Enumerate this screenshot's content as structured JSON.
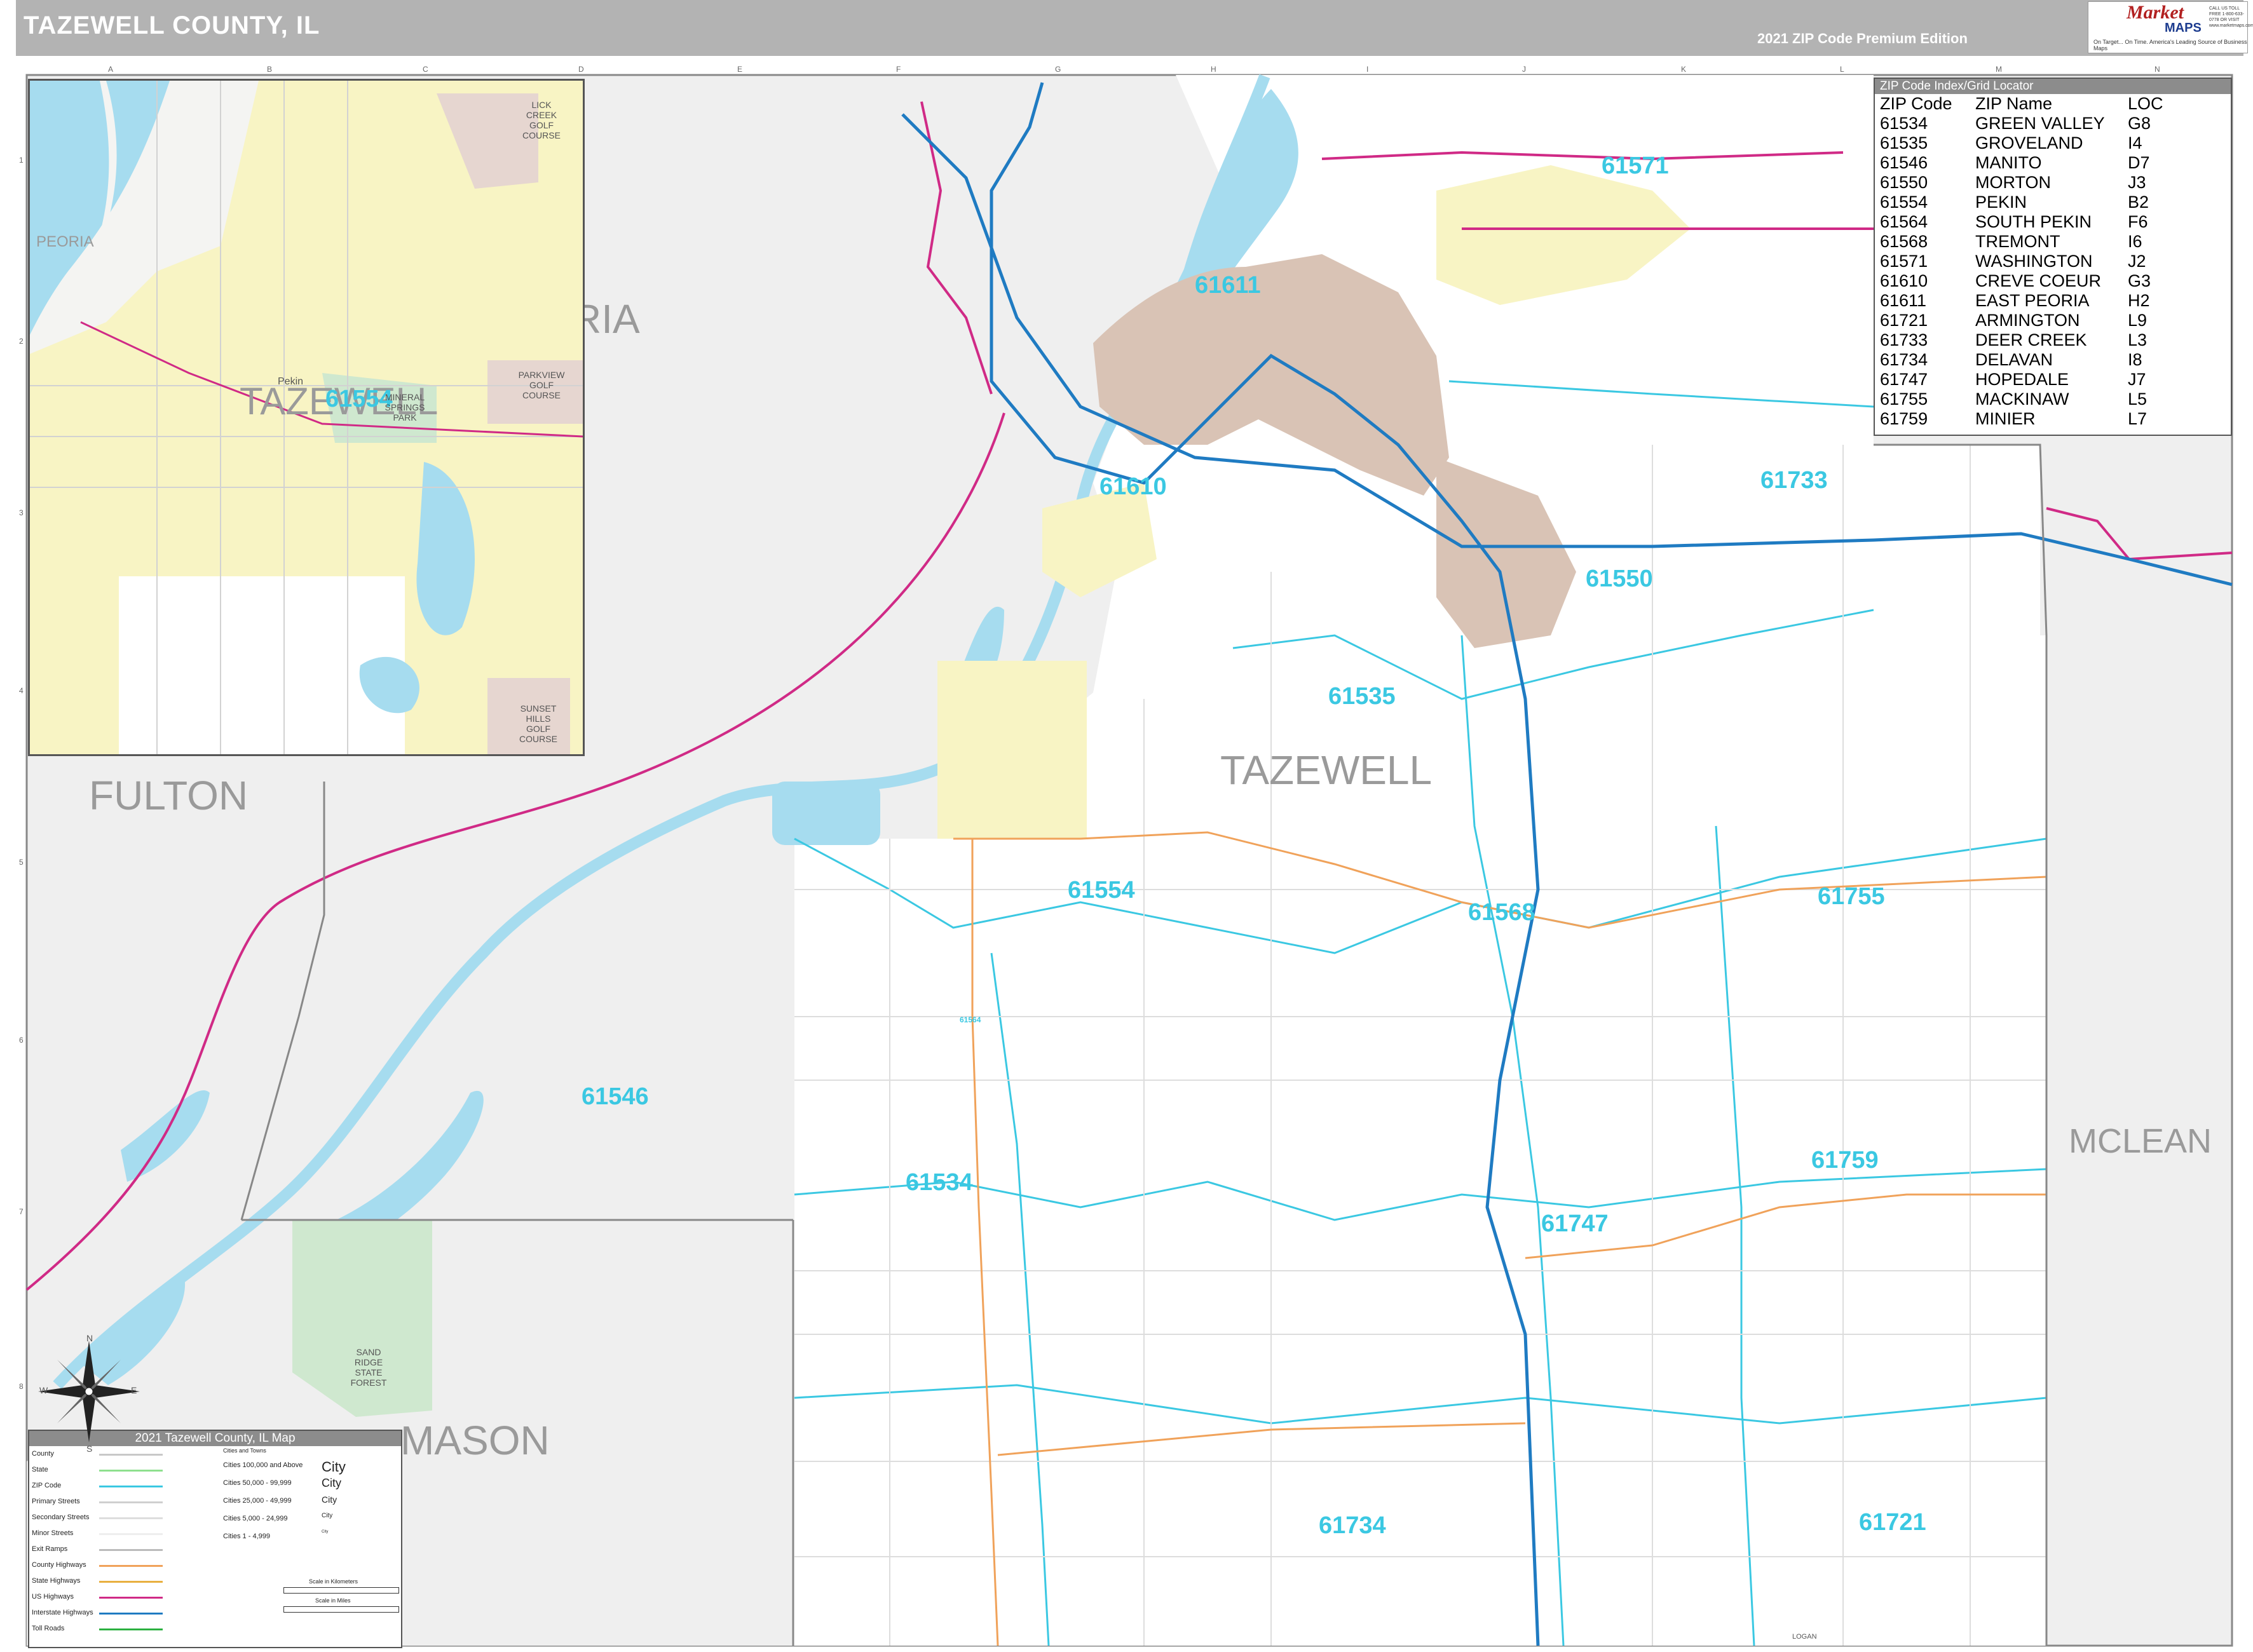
{
  "header": {
    "title": "TAZEWELL COUNTY, IL",
    "edition": "2021 ZIP Code Premium Edition",
    "logo_word": "Market",
    "logo_maps": "MAPS",
    "logo_tagline": "On Target... On Time. America's Leading Source of Business Maps",
    "logo_phone": "CALL US TOLL FREE 1-800-633-0778 OR VISIT www.marketmaps.com"
  },
  "grid_columns": [
    "A",
    "B",
    "C",
    "D",
    "E",
    "F",
    "G",
    "H",
    "I",
    "J",
    "K",
    "L",
    "M",
    "N"
  ],
  "grid_rows": [
    "1",
    "2",
    "3",
    "4",
    "5",
    "6",
    "7",
    "8"
  ],
  "counties": {
    "fulton": "FULTON",
    "mason": "MASON",
    "mclean": "MCLEAN",
    "tazewell": "TAZEWELL",
    "peoria_partial": "RIA",
    "inset_tazewell": "TAZEWELL",
    "inset_peoria": "PEORIA",
    "logan": "LOGAN"
  },
  "zip_labels": [
    {
      "zip": "61571"
    },
    {
      "zip": "61611"
    },
    {
      "zip": "61610"
    },
    {
      "zip": "61733"
    },
    {
      "zip": "61550"
    },
    {
      "zip": "61535"
    },
    {
      "zip": "61554"
    },
    {
      "zip": "61568"
    },
    {
      "zip": "61755"
    },
    {
      "zip": "61546"
    },
    {
      "zip": "61534"
    },
    {
      "zip": "61759"
    },
    {
      "zip": "61747"
    },
    {
      "zip": "61734"
    },
    {
      "zip": "61721"
    },
    {
      "zip": "61554"
    },
    {
      "zip": "61564"
    }
  ],
  "places": {
    "sand_ridge": "SAND RIDGE STATE FOREST",
    "lick_creek": "LICK CREEK GOLF COURSE",
    "parkview": "PARKVIEW GOLF COURSE",
    "mineral_springs": "MINERAL SPRINGS PARK",
    "sunset_hills": "SUNSET HILLS GOLF COURSE",
    "pekin_town": "Pekin"
  },
  "zip_index": {
    "title": "ZIP Code Index/Grid Locator",
    "headers": [
      "ZIP Code",
      "ZIP Name",
      "LOC"
    ],
    "rows": [
      [
        "61534",
        "GREEN VALLEY",
        "G8"
      ],
      [
        "61535",
        "GROVELAND",
        "I4"
      ],
      [
        "61546",
        "MANITO",
        "D7"
      ],
      [
        "61550",
        "MORTON",
        "J3"
      ],
      [
        "61554",
        "PEKIN",
        "B2"
      ],
      [
        "61564",
        "SOUTH PEKIN",
        "F6"
      ],
      [
        "61568",
        "TREMONT",
        "I6"
      ],
      [
        "61571",
        "WASHINGTON",
        "J2"
      ],
      [
        "61610",
        "CREVE COEUR",
        "G3"
      ],
      [
        "61611",
        "EAST PEORIA",
        "H2"
      ],
      [
        "61721",
        "ARMINGTON",
        "L9"
      ],
      [
        "61733",
        "DEER CREEK",
        "L3"
      ],
      [
        "61734",
        "DELAVAN",
        "I8"
      ],
      [
        "61747",
        "HOPEDALE",
        "J7"
      ],
      [
        "61755",
        "MACKINAW",
        "L5"
      ],
      [
        "61759",
        "MINIER",
        "L7"
      ]
    ]
  },
  "legend": {
    "title": "2021 Tazewell County, IL Map",
    "rows": [
      "County",
      "State",
      "ZIP Code",
      "Primary Streets",
      "Secondary Streets",
      "Minor Streets",
      "Exit Ramps",
      "County Highways",
      "State Highways",
      "US Highways",
      "Interstate Highways",
      "Toll Roads"
    ],
    "cities_header": "Cities and Towns",
    "city_rows": [
      [
        "Cities 100,000 and Above",
        "City"
      ],
      [
        "Cities 50,000 - 99,999",
        "City"
      ],
      [
        "Cities 25,000 - 49,999",
        "City"
      ],
      [
        "Cities 5,000 - 24,999",
        "City"
      ],
      [
        "Cities 1 - 4,999",
        "City"
      ]
    ],
    "scale_km": "Scale in Kilometers",
    "scale_mi": "Scale in Miles",
    "colors": {
      "county": "#c8c8c8",
      "state": "#8ee08e",
      "zip": "#3bc8e2",
      "primary": "#cfcfcf",
      "secondary": "#dddddd",
      "minor": "#eeeeee",
      "ramps": "#bbbbbb",
      "county_hwy": "#f0a25a",
      "state_hwy": "#e8b040",
      "us_hwy": "#d02a86",
      "interstate": "#1f7bc2",
      "toll": "#2bb040"
    }
  },
  "compass": {
    "n": "N",
    "s": "S",
    "e": "E",
    "w": "W"
  },
  "map_colors": {
    "water": "#a6dcef",
    "urban_dense": "#d9c3b5",
    "urban_light": "#f8f4c4",
    "outside_county": "#efefef",
    "park": "#cfe8cf"
  }
}
